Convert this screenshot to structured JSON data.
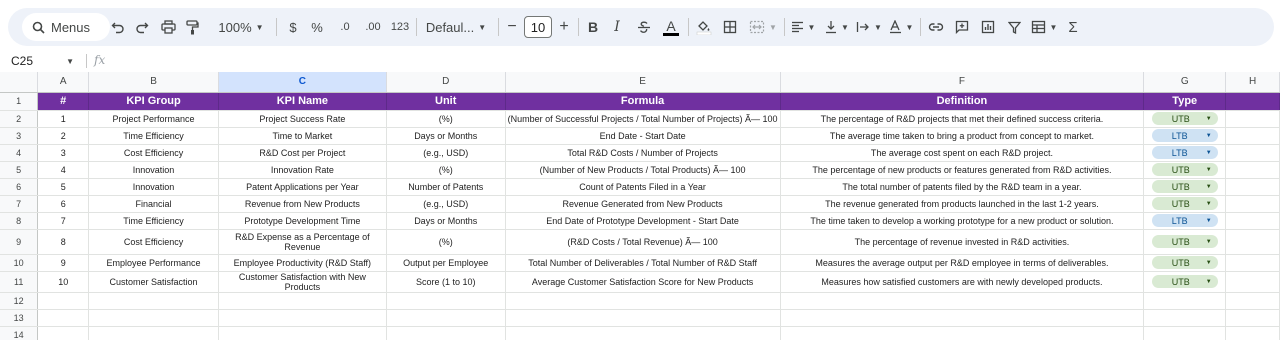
{
  "toolbar": {
    "menus_label": "Menus",
    "zoom": "100%",
    "currency": "$",
    "percent": "%",
    "dec_decrease": ".0",
    "dec_increase": ".00",
    "number_format": "123",
    "font_name": "Defaul...",
    "font_size": "10",
    "minus": "−",
    "plus": "+",
    "bold": "B",
    "italic": "I",
    "text_color_letter": "A",
    "sum": "Σ"
  },
  "formula_bar": {
    "cell_ref": "C25",
    "fx": "fx"
  },
  "columns": [
    "A",
    "B",
    "C",
    "D",
    "E",
    "F",
    "G",
    "H"
  ],
  "row_numbers": [
    "1",
    "2",
    "3",
    "4",
    "5",
    "6",
    "7",
    "8",
    "9",
    "10",
    "11",
    "12",
    "13",
    "14"
  ],
  "header": [
    "#",
    "KPI Group",
    "KPI Name",
    "Unit",
    "Formula",
    "Definition",
    "Type"
  ],
  "rows": [
    {
      "n": "1",
      "group": "Project Performance",
      "name": "Project Success Rate",
      "unit": "(%)",
      "formula": "(Number of Successful Projects / Total Number of Projects) Ã— 100",
      "definition": "The percentage of R&D projects that met their defined success criteria.",
      "type": "UTB"
    },
    {
      "n": "2",
      "group": "Time Efficiency",
      "name": "Time to Market",
      "unit": "Days or Months",
      "formula": "End Date - Start Date",
      "definition": "The average time taken to bring a product from concept to market.",
      "type": "LTB"
    },
    {
      "n": "3",
      "group": "Cost Efficiency",
      "name": "R&D Cost per Project",
      "unit": "(e.g., USD)",
      "formula": "Total R&D Costs / Number of Projects",
      "definition": "The average cost spent on each R&D project.",
      "type": "LTB"
    },
    {
      "n": "4",
      "group": "Innovation",
      "name": "Innovation Rate",
      "unit": "(%)",
      "formula": "(Number of New Products / Total Products) Ã— 100",
      "definition": "The percentage of new products or features generated from R&D activities.",
      "type": "UTB"
    },
    {
      "n": "5",
      "group": "Innovation",
      "name": "Patent Applications per Year",
      "unit": "Number of Patents",
      "formula": "Count of Patents Filed in a Year",
      "definition": "The total number of patents filed by the R&D team in a year.",
      "type": "UTB"
    },
    {
      "n": "6",
      "group": "Financial",
      "name": "Revenue from New Products",
      "unit": "(e.g., USD)",
      "formula": "Revenue Generated from New Products",
      "definition": "The revenue generated from products launched in the last 1-2 years.",
      "type": "UTB"
    },
    {
      "n": "7",
      "group": "Time Efficiency",
      "name": "Prototype Development Time",
      "unit": "Days or Months",
      "formula": "End Date of Prototype Development - Start Date",
      "definition": "The time taken to develop a working prototype for a new product or solution.",
      "type": "LTB"
    },
    {
      "n": "8",
      "group": "Cost Efficiency",
      "name": "R&D Expense as a Percentage of Revenue",
      "unit": "(%)",
      "formula": "(R&D Costs / Total Revenue) Ã— 100",
      "definition": "The percentage of revenue invested in R&D activities.",
      "type": "UTB"
    },
    {
      "n": "9",
      "group": "Employee Performance",
      "name": "Employee Productivity (R&D Staff)",
      "unit": "Output per Employee",
      "formula": "Total Number of Deliverables / Total Number of R&D Staff",
      "definition": "Measures the average output per R&D employee in terms of deliverables.",
      "type": "UTB"
    },
    {
      "n": "10",
      "group": "Customer Satisfaction",
      "name": "Customer Satisfaction with New Products",
      "unit": "Score (1 to 10)",
      "formula": "Average Customer Satisfaction Score for New Products",
      "definition": "Measures how satisfied customers are with newly developed products.",
      "type": "UTB"
    }
  ],
  "colors": {
    "header_bg": "#7030a0",
    "utb_chip": "#d9ead3",
    "ltb_chip": "#cfe2f3",
    "selected_col": "#d3e3fd"
  }
}
